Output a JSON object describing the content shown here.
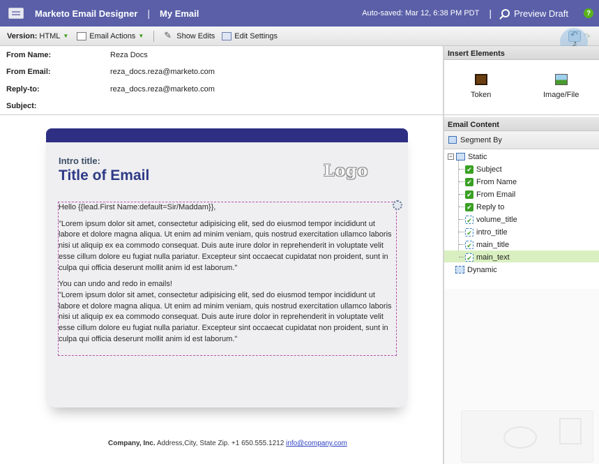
{
  "titlebar": {
    "app_name": "Marketo Email Designer",
    "separator": "|",
    "email_name": "My Email",
    "autosave": "Auto-saved: Mar 12, 6:38 PM PDT",
    "separator2": "|",
    "preview_label": "Preview Draft",
    "help": "?"
  },
  "toolbar": {
    "version_label": "Version:",
    "version_value": "HTML",
    "email_actions": "Email Actions",
    "show_edits": "Show Edits",
    "edit_settings": "Edit Settings"
  },
  "fields": {
    "from_name_label": "From Name:",
    "from_name_value": "Reza Docs",
    "from_email_label": "From Email:",
    "from_email_value": "reza_docs.reza@marketo.com",
    "reply_to_label": "Reply-to:",
    "reply_to_value": "reza_docs.reza@marketo.com",
    "subject_label": "Subject:",
    "subject_value": ""
  },
  "email": {
    "intro_title": "Intro title:",
    "title": "Title of Email",
    "logo": "Logo",
    "greeting": "Hello {{lead.First Name:default=Sir/Maddam}},",
    "para1": "\"Lorem ipsum dolor sit amet, consectetur adipisicing elit, sed do eiusmod tempor incididunt ut labore et dolore magna aliqua. Ut enim ad minim veniam, quis nostrud exercitation ullamco laboris nisi ut aliquip ex ea commodo consequat. Duis aute irure dolor in reprehenderit in voluptate velit esse cillum dolore eu fugiat nulla pariatur. Excepteur sint occaecat cupidatat non proident, sunt in culpa qui officia deserunt mollit anim id est laborum.\"",
    "undo_line": "You can undo and redo in emails!",
    "para2": "\"Lorem ipsum dolor sit amet, consectetur adipisicing elit, sed do eiusmod tempor incididunt ut labore et dolore magna aliqua. Ut enim ad minim veniam, quis nostrud exercitation ullamco laboris nisi ut aliquip ex ea commodo consequat. Duis aute irure dolor in reprehenderit in voluptate velit esse cillum dolore eu fugiat nulla pariatur. Excepteur sint occaecat cupidatat non proident, sunt in culpa qui officia deserunt mollit anim id est laborum.\"",
    "footer_company": "Company, Inc.",
    "footer_address": " Address,City, State Zip. +1 650.555.1212 ",
    "footer_link": "info@company.com"
  },
  "insert_elements": {
    "header": "Insert Elements",
    "items": [
      {
        "label": "Token",
        "icon": "token-icon"
      },
      {
        "label": "Image/File",
        "icon": "image-icon"
      }
    ]
  },
  "email_content": {
    "header": "Email Content",
    "segment_by": "Segment By",
    "tree": {
      "static": "Static",
      "children": [
        "Subject",
        "From Name",
        "From Email",
        "Reply to",
        "volume_title",
        "intro_title",
        "main_title",
        "main_text"
      ],
      "selected": "main_text",
      "dynamic": "Dynamic"
    }
  },
  "colors": {
    "titlebar_bg": "#5a5fa8",
    "email_header_bar": "#2e2f82",
    "email_title": "#2f3a86",
    "selection": "#d9efc0"
  }
}
